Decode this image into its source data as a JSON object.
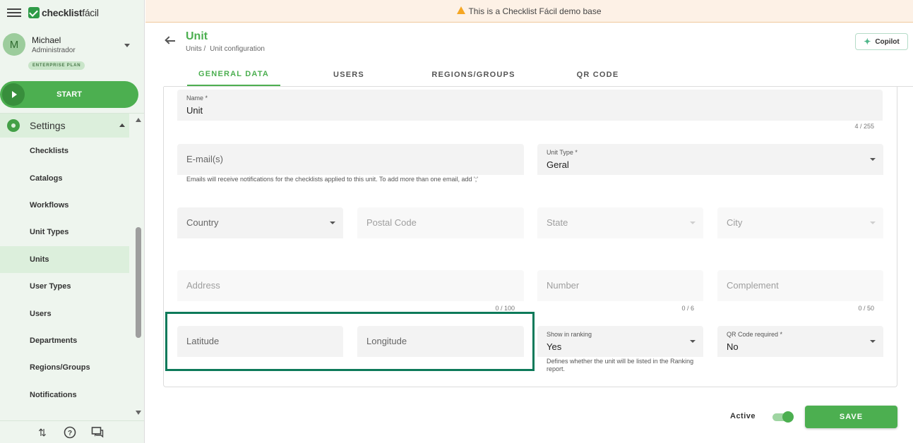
{
  "app": {
    "logo_bold": "checklist",
    "logo_thin": "fácil"
  },
  "user": {
    "initial": "M",
    "name": "Michael",
    "role": "Administrador",
    "plan": "ENTERPRISE PLAN"
  },
  "start_label": "START",
  "sidebar": {
    "section_label": "Settings",
    "items": [
      {
        "label": "Checklists"
      },
      {
        "label": "Catalogs"
      },
      {
        "label": "Workflows"
      },
      {
        "label": "Unit Types"
      },
      {
        "label": "Units",
        "active": true
      },
      {
        "label": "User Types"
      },
      {
        "label": "Users"
      },
      {
        "label": "Departments"
      },
      {
        "label": "Regions/Groups"
      },
      {
        "label": "Notifications"
      }
    ],
    "footer_icons": [
      "sort-arrows-icon",
      "help-icon",
      "chat-icon"
    ]
  },
  "banner": {
    "text": "This is a Checklist Fácil demo base"
  },
  "header": {
    "title": "Unit",
    "breadcrumb_root": "Units /",
    "breadcrumb_current": "Unit configuration",
    "copilot_label": "Copilot"
  },
  "tabs": [
    {
      "label": "GENERAL DATA",
      "active": true
    },
    {
      "label": "USERS"
    },
    {
      "label": "REGIONS/GROUPS"
    },
    {
      "label": "QR CODE"
    }
  ],
  "form": {
    "name": {
      "label": "Name *",
      "value": "Unit",
      "counter": "4 / 255"
    },
    "email": {
      "placeholder": "E-mail(s)",
      "hint": "Emails will receive notifications for the checklists applied to this unit. To add more than one email, add ';'"
    },
    "unit_type": {
      "label": "Unit Type *",
      "value": "Geral"
    },
    "country": {
      "placeholder": "Country"
    },
    "postal_code": {
      "placeholder": "Postal Code"
    },
    "state": {
      "placeholder": "State"
    },
    "city": {
      "placeholder": "City"
    },
    "address": {
      "placeholder": "Address",
      "counter": "0 / 100"
    },
    "number": {
      "placeholder": "Number",
      "counter": "0 / 6"
    },
    "complement": {
      "placeholder": "Complement",
      "counter": "0 / 50"
    },
    "latitude": {
      "placeholder": "Latitude"
    },
    "longitude": {
      "placeholder": "Longitude"
    },
    "show_in_ranking": {
      "label": "Show in ranking",
      "value": "Yes",
      "hint": "Defines whether the unit will be listed in the Ranking report."
    },
    "qr_code_required": {
      "label": "QR Code required *",
      "value": "No"
    }
  },
  "footer": {
    "active_label": "Active",
    "active_on": true,
    "save_label": "SAVE"
  },
  "colors": {
    "accent": "#4caf50",
    "highlight": "#0d7a5a",
    "banner_bg": "#fdf1e6",
    "warning": "#f5a623"
  }
}
